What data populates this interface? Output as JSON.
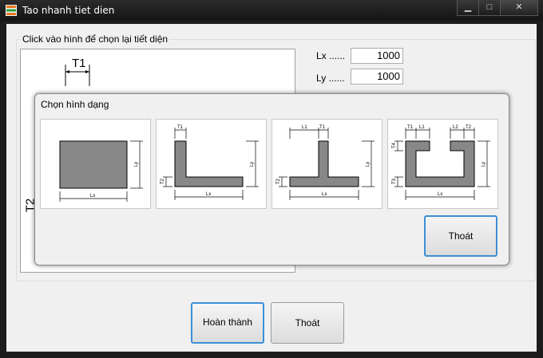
{
  "window": {
    "title": "Tao nhanh tiet dien",
    "minimize": "▁",
    "maximize": "□",
    "close": "✕"
  },
  "group": {
    "label": "Click vào hình để chọn lại tiết diện"
  },
  "preview": {
    "t1": "T1",
    "t2": "T2"
  },
  "fields": {
    "lx_label": "Lx ......",
    "lx_value": "1000",
    "ly_label": "Ly ......",
    "ly_value": "1000"
  },
  "popup": {
    "title": "Chọn hình dạng",
    "exit_label": "Thoát",
    "shapes": [
      {
        "name": "rectangle",
        "labels": {
          "lx": "Lx",
          "ly": "Ly"
        }
      },
      {
        "name": "l-shape",
        "labels": {
          "t1": "T1",
          "t2": "T2",
          "lx": "Lx",
          "ly": "Ly"
        }
      },
      {
        "name": "t-shape",
        "labels": {
          "l1": "L1",
          "t1": "T1",
          "t2": "T2",
          "lx": "Lx",
          "ly": "Ly"
        }
      },
      {
        "name": "c-shape",
        "labels": {
          "t1": "T1",
          "l1": "L1",
          "l2": "L2",
          "t2": "T2",
          "t4": "T4",
          "t3": "T3",
          "lx": "Lx",
          "ly": "Ly"
        }
      }
    ]
  },
  "buttons": {
    "finish": "Hoàn thành",
    "exit": "Thoát"
  }
}
